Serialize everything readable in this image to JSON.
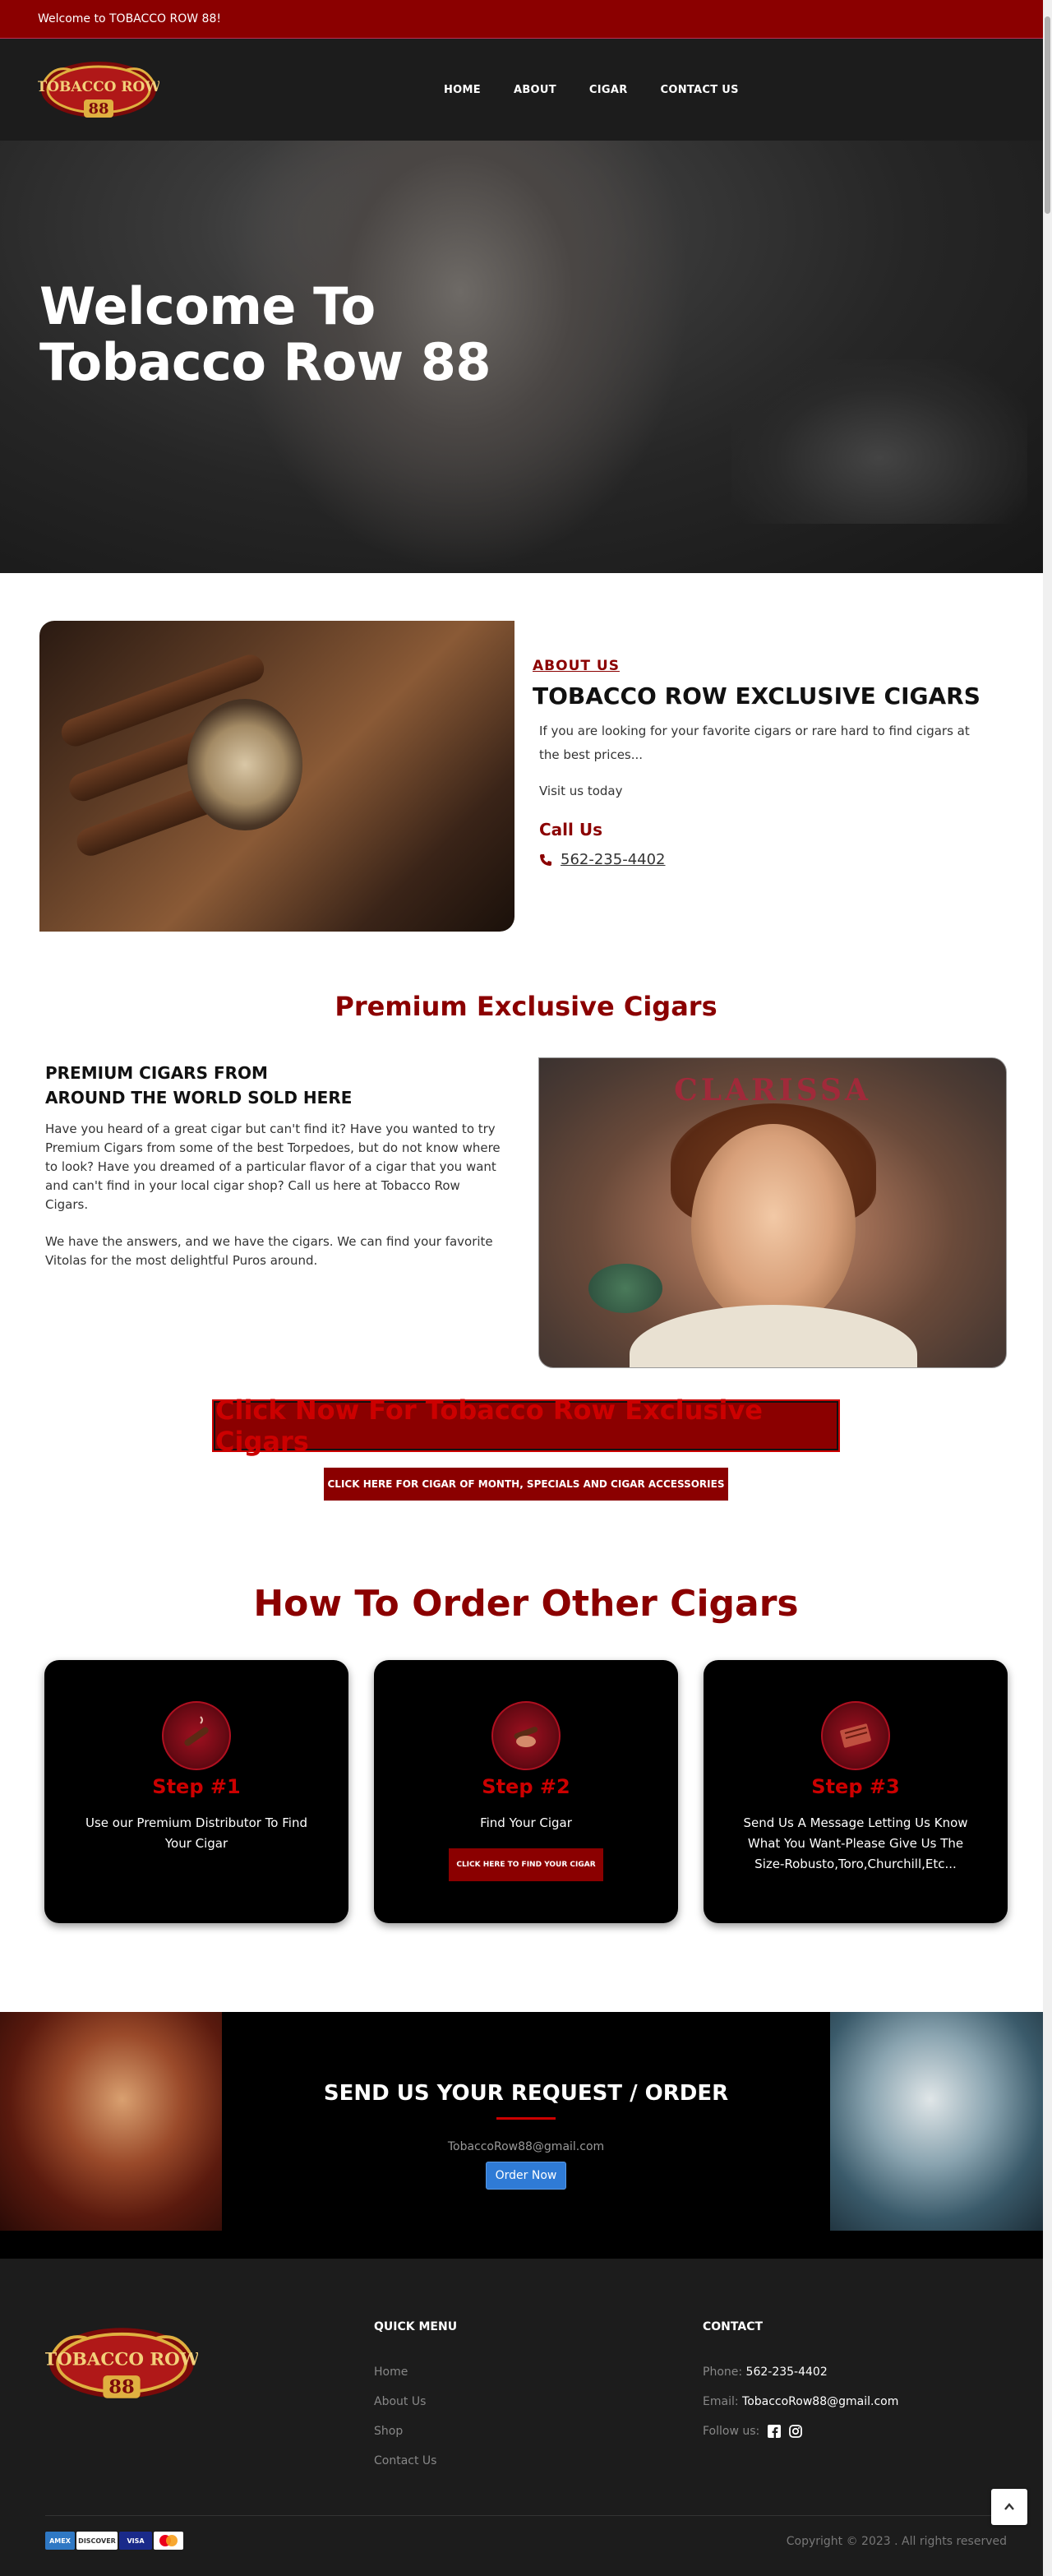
{
  "topbar": {
    "welcome": "Welcome to TOBACCO ROW 88!"
  },
  "header": {
    "logo_text_top": "TOBACCO ROW",
    "logo_text_bottom": "88",
    "nav": [
      "HOME",
      "ABOUT",
      "CIGAR",
      "CONTACT US"
    ]
  },
  "hero": {
    "title_line1": "Welcome To",
    "title_line2": "Tobacco Row 88"
  },
  "about": {
    "label": "ABOUT US",
    "title": "TOBACCO ROW EXCLUSIVE CIGARS",
    "desc": "If you are looking for your favorite cigars or rare hard to find cigars at the best prices...",
    "visit": "Visit us today",
    "call_label": "Call Us",
    "phone": "562-235-4402"
  },
  "premium": {
    "title": "Premium Exclusive Cigars",
    "sub_line1": "PREMIUM CIGARS FROM",
    "sub_line2": "AROUND THE WORLD SOLD HERE",
    "para1": "Have you heard of a great cigar but can't find it? Have you wanted to try Premium Cigars from some of the best Torpedoes, but do not know where to look? Have you dreamed of a particular flavor of a cigar that you want and can't find in your local cigar shop? Call us here at Tobacco Row Cigars.",
    "para2": "We have the answers, and we have the cigars. We can find your favorite Vitolas for the most delightful Puros around.",
    "image_label": "CLARISSA"
  },
  "cta": {
    "big": "Click Now For Tobacco Row Exclusive Cigars",
    "small": "CLICK HERE FOR CIGAR OF MONTH, SPECIALS AND CIGAR ACCESSORIES"
  },
  "how": {
    "title": "How To Order Other Cigars",
    "steps": [
      {
        "title": "Step #1",
        "desc": "Use our Premium Distributor To Find Your Cigar",
        "icon": "cigar-icon"
      },
      {
        "title": "Step #2",
        "desc": "Find Your Cigar",
        "button": "CLICK HERE TO FIND YOUR CIGAR",
        "icon": "hand-cigar-icon"
      },
      {
        "title": "Step #3",
        "desc": "Send Us A Message Letting Us Know What You Want-Please Give Us The Size-Robusto,Toro,Churchill,Etc...",
        "icon": "cigar-box-icon"
      }
    ]
  },
  "request": {
    "title": "SEND US YOUR REQUEST / ORDER",
    "email": "TobaccoRow88@gmail.com",
    "button": "Order Now"
  },
  "footer": {
    "quick_title": "QUICK MENU",
    "quick_links": [
      "Home",
      "About Us",
      "Shop",
      "Contact Us"
    ],
    "contact_title": "CONTACT",
    "phone_label": "Phone:",
    "phone": "562-235-4402",
    "email_label": "Email:",
    "email": "TobaccoRow88@gmail.com",
    "follow_label": "Follow us:",
    "copyright": "Copyright © 2023 . All rights reserved",
    "payments": [
      "AMEX",
      "DISCOVER",
      "VISA",
      "MC"
    ]
  },
  "colors": {
    "brand_red": "#8b0000",
    "header_bg": "#1c1c1c",
    "order_blue": "#2f7bd6"
  }
}
